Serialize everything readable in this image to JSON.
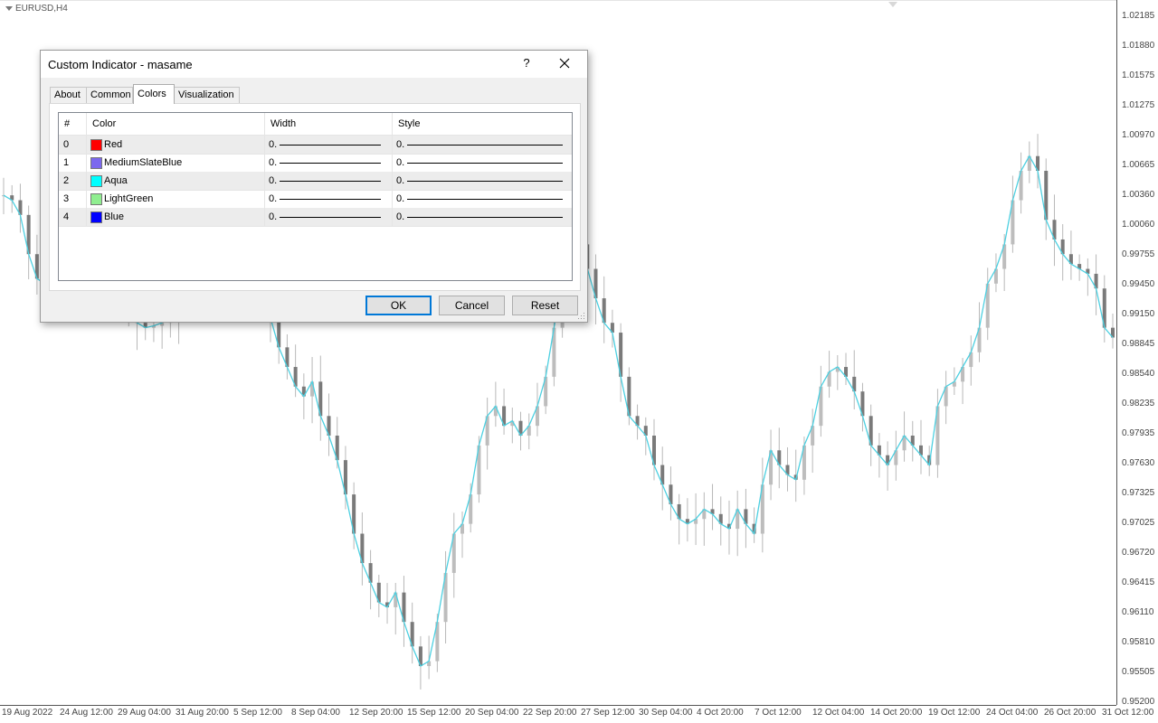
{
  "chart": {
    "symbol": "EURUSD,H4",
    "price_axis": [
      "1.02185",
      "1.01880",
      "1.01575",
      "1.01275",
      "1.00970",
      "1.00665",
      "1.00360",
      "1.00060",
      "0.99755",
      "0.99450",
      "0.99150",
      "0.98845",
      "0.98540",
      "0.98235",
      "0.97935",
      "0.97630",
      "0.97325",
      "0.97025",
      "0.96720",
      "0.96415",
      "0.96110",
      "0.95810",
      "0.95505",
      "0.95200"
    ],
    "time_axis": [
      "19 Aug 2022",
      "24 Aug 12:00",
      "29 Aug 04:00",
      "31 Aug 20:00",
      "5 Sep 12:00",
      "8 Sep 04:00",
      "12 Sep 20:00",
      "15 Sep 12:00",
      "20 Sep 04:00",
      "22 Sep 20:00",
      "27 Sep 12:00",
      "30 Sep 04:00",
      "4 Oct 20:00",
      "7 Oct 12:00",
      "12 Oct 04:00",
      "14 Oct 20:00",
      "19 Oct 12:00",
      "24 Oct 04:00",
      "26 Oct 20:00",
      "31 Oct 12:00"
    ],
    "colors": {
      "candle": "#7a7a7a",
      "ma_line": "#4dd0e1"
    }
  },
  "chart_data": {
    "type": "line",
    "title": "EURUSD,H4",
    "series": [
      {
        "name": "EURUSD,H4",
        "y": [
          1.0035,
          1.003,
          1.0015,
          0.9975,
          0.995,
          0.9945,
          0.9935,
          0.994,
          0.9945,
          0.995,
          0.996,
          0.9955,
          0.995,
          0.9945,
          0.993,
          0.9915,
          0.9905,
          0.99,
          0.9902,
          0.9905,
          0.991,
          0.994,
          0.996,
          0.9975,
          0.999,
          1.0005,
          1.0015,
          1.002,
          1.001,
          0.9995,
          0.997,
          0.9945,
          0.991,
          0.988,
          0.986,
          0.984,
          0.983,
          0.9845,
          0.981,
          0.979,
          0.9765,
          0.973,
          0.969,
          0.966,
          0.964,
          0.962,
          0.9615,
          0.963,
          0.96,
          0.9575,
          0.9555,
          0.956,
          0.96,
          0.965,
          0.969,
          0.97,
          0.973,
          0.978,
          0.981,
          0.982,
          0.98,
          0.9805,
          0.979,
          0.98,
          0.982,
          0.985,
          0.99,
          0.995,
          0.9975,
          0.9985,
          0.996,
          0.993,
          0.9905,
          0.9895,
          0.985,
          0.981,
          0.98,
          0.979,
          0.976,
          0.974,
          0.972,
          0.9705,
          0.97,
          0.9705,
          0.9715,
          0.971,
          0.97,
          0.9695,
          0.9715,
          0.97,
          0.969,
          0.974,
          0.9775,
          0.976,
          0.975,
          0.9745,
          0.978,
          0.98,
          0.984,
          0.9855,
          0.986,
          0.985,
          0.9835,
          0.981,
          0.978,
          0.977,
          0.976,
          0.9775,
          0.979,
          0.978,
          0.977,
          0.976,
          0.982,
          0.984,
          0.9845,
          0.986,
          0.9875,
          0.99,
          0.9945,
          0.996,
          0.9985,
          1.003,
          1.006,
          1.0075,
          1.006,
          1.001,
          0.999,
          0.9975,
          0.9965,
          0.996,
          0.9955,
          0.994,
          0.99,
          0.989
        ]
      }
    ],
    "ylim": [
      0.952,
      1.02185
    ],
    "grid": false
  },
  "dialog": {
    "title": "Custom Indicator - masame",
    "help_glyph": "?",
    "tabs": [
      "About",
      "Common",
      "Colors",
      "Visualization"
    ],
    "active_tab": "Colors",
    "columns": [
      "#",
      "Color",
      "Width",
      "Style"
    ],
    "rows": [
      {
        "index": "0",
        "color_name": "Red",
        "swatch": "#ff0000",
        "width": "0.",
        "style": "0."
      },
      {
        "index": "1",
        "color_name": "MediumSlateBlue",
        "swatch": "#7b68ee",
        "width": "0.",
        "style": "0."
      },
      {
        "index": "2",
        "color_name": "Aqua",
        "swatch": "#00ffff",
        "width": "0.",
        "style": "0."
      },
      {
        "index": "3",
        "color_name": "LightGreen",
        "swatch": "#90ee90",
        "width": "0.",
        "style": "0."
      },
      {
        "index": "4",
        "color_name": "Blue",
        "swatch": "#0000ff",
        "width": "0.",
        "style": "0."
      }
    ],
    "buttons": {
      "ok": "OK",
      "cancel": "Cancel",
      "reset": "Reset"
    }
  }
}
